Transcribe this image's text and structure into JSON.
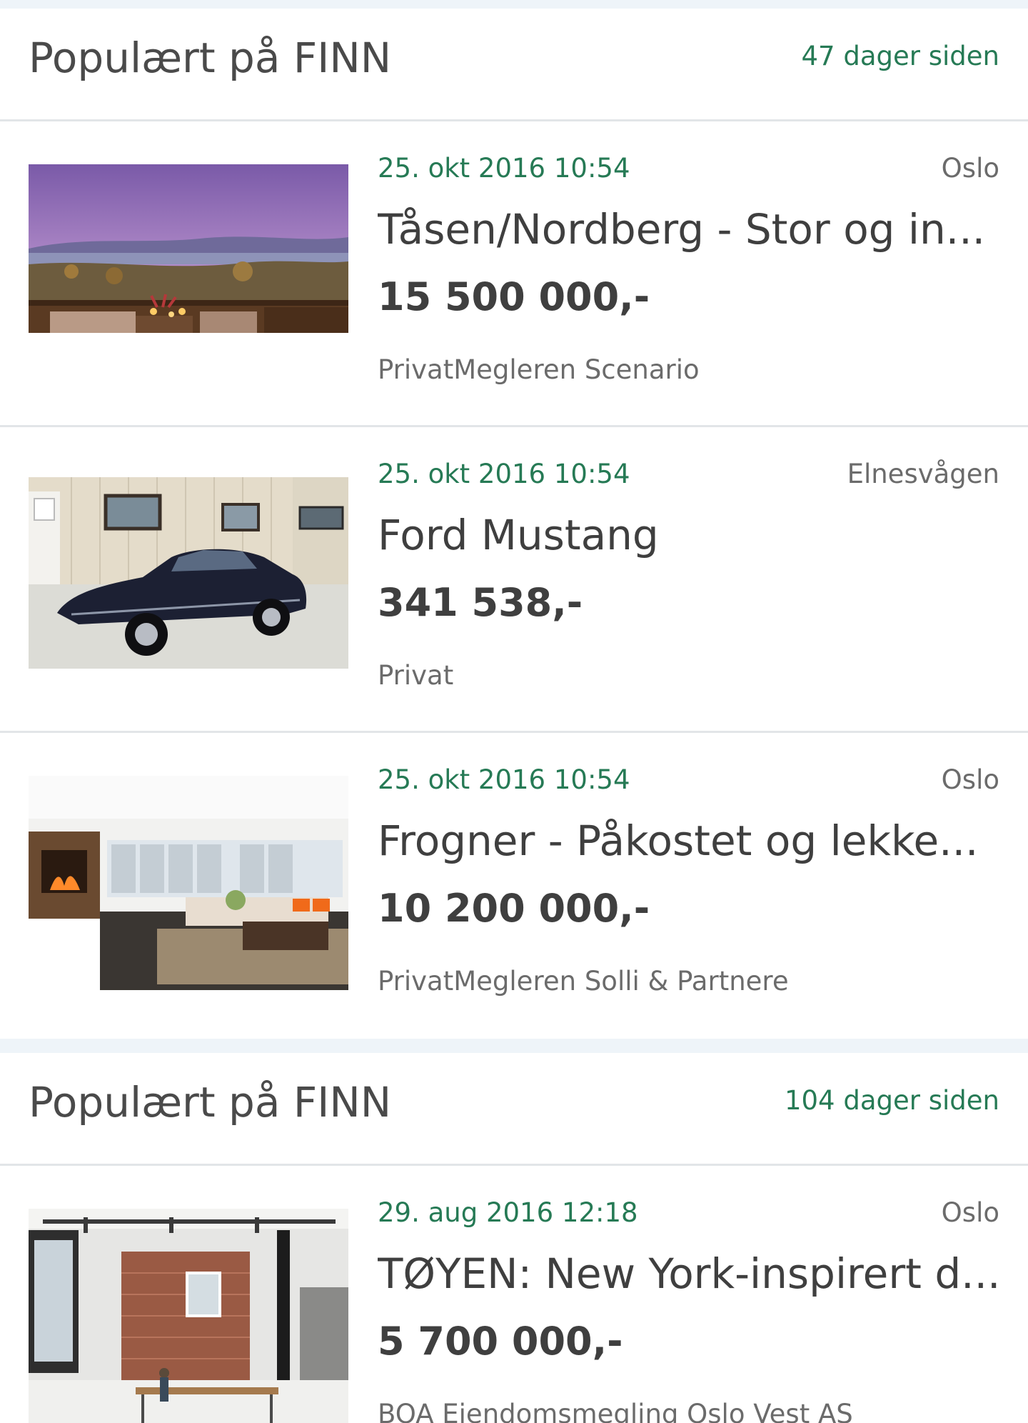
{
  "sections": [
    {
      "title": "Populært på FINN",
      "age": "47 dager siden",
      "listings": [
        {
          "date": "25. okt 2016 10:54",
          "location": "Oslo",
          "title": "Tåsen/Nordberg - Stor og in...",
          "price": "15 500 000,-",
          "seller": "PrivatMegleren Scenario",
          "image_icon": "terrace-view-photo"
        },
        {
          "date": "25. okt 2016 10:54",
          "location": "Elnesvågen",
          "title": "Ford Mustang",
          "price": "341 538,-",
          "seller": "Privat",
          "image_icon": "car-photo"
        },
        {
          "date": "25. okt 2016 10:54",
          "location": "Oslo",
          "title": "Frogner - Påkostet og lekke...",
          "price": "10 200 000,-",
          "seller": "PrivatMegleren Solli & Partnere",
          "image_icon": "living-room-photo"
        }
      ]
    },
    {
      "title": "Populært på FINN",
      "age": "104 dager siden",
      "listings": [
        {
          "date": "29. aug 2016 12:18",
          "location": "Oslo",
          "title": "TØYEN: New York-inspirert d...",
          "price": "5 700 000,-",
          "seller": "BOA Eiendomsmegling Oslo Vest AS",
          "image_icon": "loft-apartment-photo"
        }
      ]
    }
  ],
  "colors": {
    "accent_green": "#267a55",
    "text_dark": "#3f3f3f",
    "text_muted": "#6b6b6b",
    "divider": "#e2e5e8",
    "page_background": "#eef4f9"
  }
}
